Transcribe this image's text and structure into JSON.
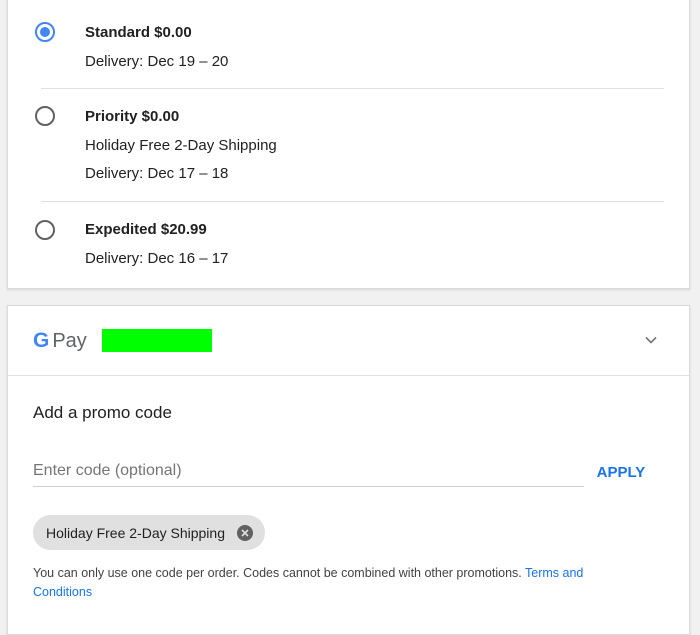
{
  "shipping_options": [
    {
      "title": "Standard $0.00",
      "lines": [
        "Delivery: Dec 19 – 20"
      ],
      "selected": true
    },
    {
      "title": "Priority $0.00",
      "lines": [
        "Holiday Free 2-Day Shipping",
        "Delivery: Dec 17 – 18"
      ],
      "selected": false
    },
    {
      "title": "Expedited $20.99",
      "lines": [
        "Delivery: Dec 16 – 17"
      ],
      "selected": false
    }
  ],
  "payment": {
    "logo_g": "G",
    "logo_word": "Pay",
    "redacted_color": "#00ff00",
    "chevron_icon": "chevron-down-icon"
  },
  "promo": {
    "title": "Add a promo code",
    "placeholder": "Enter code (optional)",
    "value": "",
    "apply_label": "APPLY",
    "applied_chip": "Holiday Free 2-Day Shipping",
    "chip_remove_icon": "close-circle-icon",
    "notice_text": "You can only use one code per order. Codes cannot be combined with other promotions.",
    "notice_link": "Terms and Conditions"
  },
  "colors": {
    "accent_blue": "#4285f4",
    "link_blue": "#1a73e8",
    "google_blue": "#4285f4",
    "google_red": "#ea4335",
    "google_yellow": "#fbbc05",
    "google_green": "#34a853"
  }
}
